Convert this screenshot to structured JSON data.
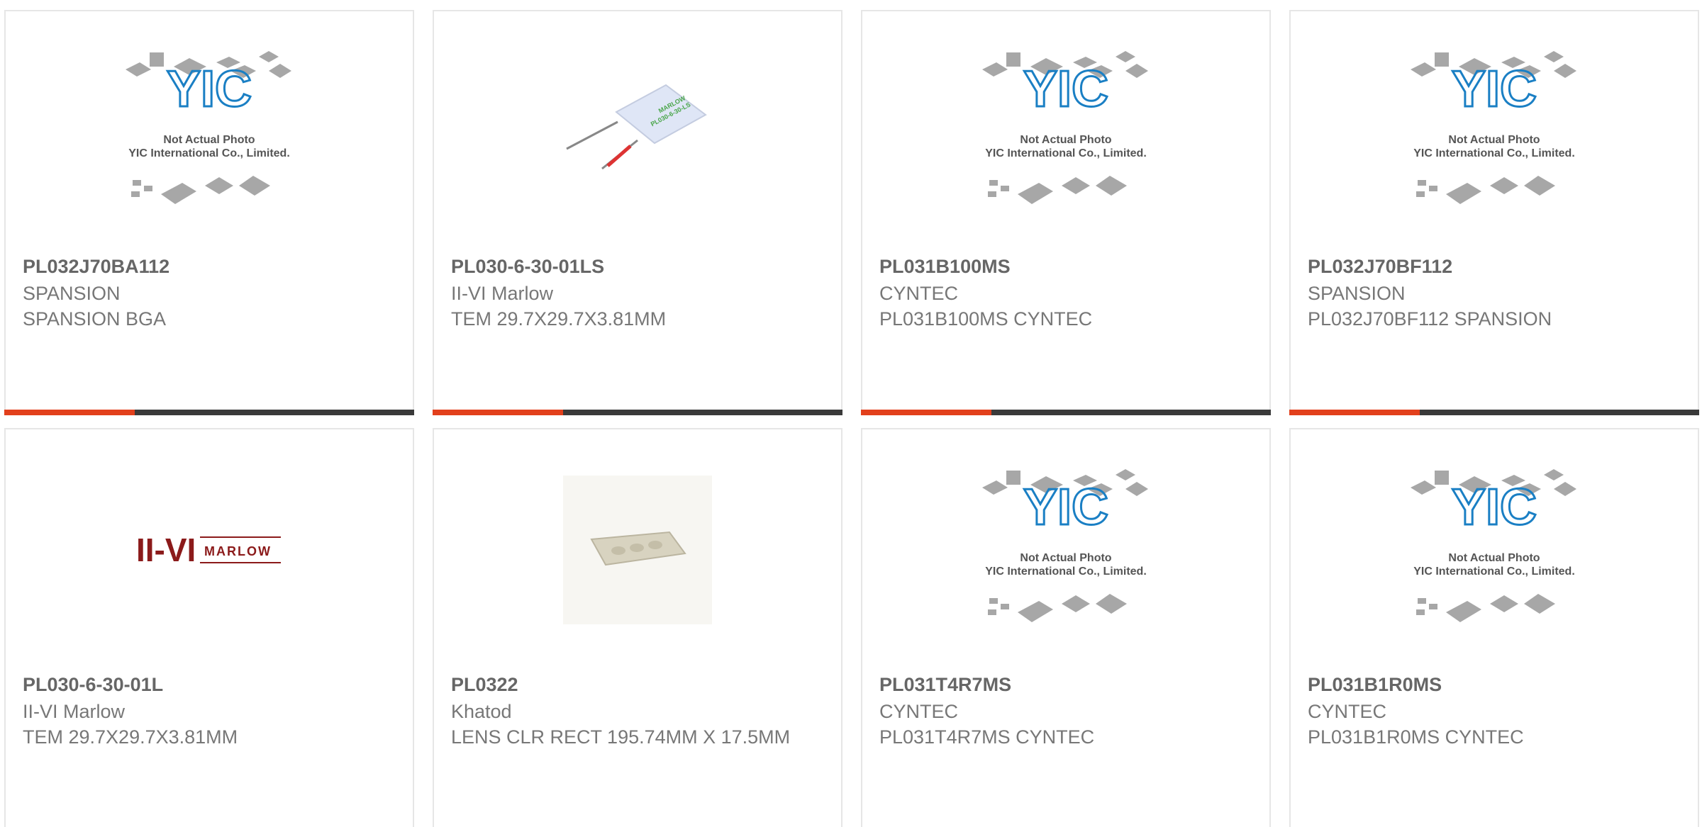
{
  "products": [
    {
      "part_number": "PL032J70BA112",
      "manufacturer": "SPANSION",
      "description": "SPANSION BGA",
      "image": "placeholder",
      "placeholder_line1": "Not Actual Photo",
      "placeholder_line2": "YIC International Co., Limited."
    },
    {
      "part_number": "PL030-6-30-01LS",
      "manufacturer": "II-VI Marlow",
      "description": "TEM 29.7X29.7X3.81MM",
      "image": "tec-module",
      "module_label_1": "MARLOW",
      "module_label_2": "PL030-6-30-LS"
    },
    {
      "part_number": "PL031B100MS",
      "manufacturer": "CYNTEC",
      "description": "PL031B100MS CYNTEC",
      "image": "placeholder",
      "placeholder_line1": "Not Actual Photo",
      "placeholder_line2": "YIC International Co., Limited."
    },
    {
      "part_number": "PL032J70BF112",
      "manufacturer": "SPANSION",
      "description": "PL032J70BF112 SPANSION",
      "image": "placeholder",
      "placeholder_line1": "Not Actual Photo",
      "placeholder_line2": "YIC International Co., Limited."
    },
    {
      "part_number": "PL030-6-30-01L",
      "manufacturer": "II-VI Marlow",
      "description": "TEM 29.7X29.7X3.81MM",
      "image": "marlow-logo",
      "logo_left": "II-VI",
      "logo_right": "MARLOW"
    },
    {
      "part_number": "PL0322",
      "manufacturer": "Khatod",
      "description": "LENS CLR RECT 195.74MM X 17.5MM",
      "image": "lens-strip"
    },
    {
      "part_number": "PL031T4R7MS",
      "manufacturer": "CYNTEC",
      "description": "PL031T4R7MS CYNTEC",
      "image": "placeholder",
      "placeholder_line1": "Not Actual Photo",
      "placeholder_line2": "YIC International Co., Limited."
    },
    {
      "part_number": "PL031B1R0MS",
      "manufacturer": "CYNTEC",
      "description": "PL031B1R0MS CYNTEC",
      "image": "placeholder",
      "placeholder_line1": "Not Actual Photo",
      "placeholder_line2": "YIC International Co., Limited."
    }
  ],
  "colors": {
    "accent": "#e2401c",
    "bar": "#3a3a3a",
    "yic_blue": "#1a7fc4",
    "marlow_red": "#8b1a1a"
  }
}
